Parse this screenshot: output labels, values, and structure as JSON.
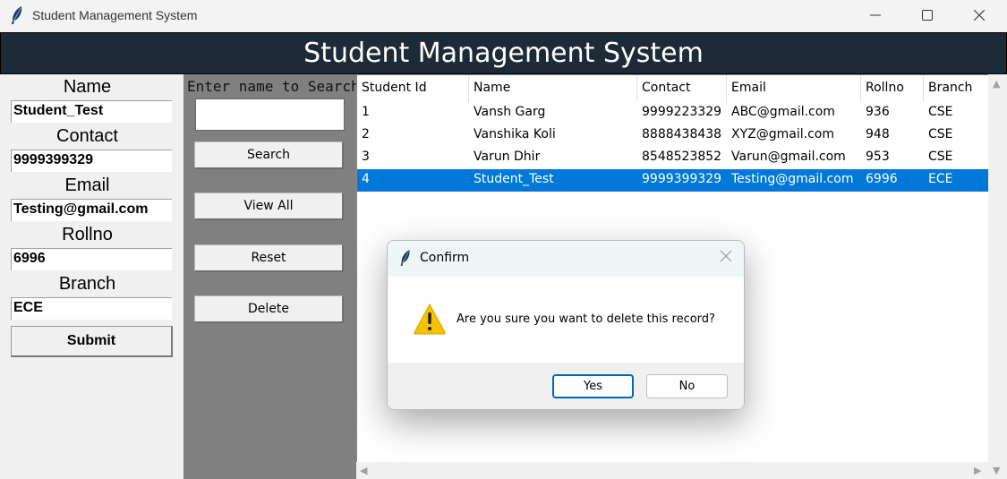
{
  "window": {
    "title": "Student Management System"
  },
  "banner": {
    "title": "Student Management System"
  },
  "form": {
    "name_label": "Name",
    "name_value": "Student_Test",
    "contact_label": "Contact",
    "contact_value": "9999399329",
    "email_label": "Email",
    "email_value": "Testing@gmail.com",
    "rollno_label": "Rollno",
    "rollno_value": "6996",
    "branch_label": "Branch",
    "branch_value": "ECE",
    "submit_label": "Submit"
  },
  "search": {
    "label": "Enter name to Search",
    "value": "",
    "search_label": "Search",
    "view_all_label": "View All",
    "reset_label": "Reset",
    "delete_label": "Delete"
  },
  "table": {
    "columns": [
      "Student Id",
      "Name",
      "Contact",
      "Email",
      "Rollno",
      "Branch"
    ],
    "rows": [
      [
        "1",
        "Vansh Garg",
        "9999223329",
        "ABC@gmail.com",
        "936",
        "CSE"
      ],
      [
        "2",
        "Vanshika Koli",
        "8888438438",
        "XYZ@gmail.com",
        "948",
        "CSE"
      ],
      [
        "3",
        "Varun Dhir",
        "8548523852",
        "Varun@gmail.com",
        "953",
        "CSE"
      ],
      [
        "4",
        "Student_Test",
        "9999399329",
        "Testing@gmail.com",
        "6996",
        "ECE"
      ]
    ],
    "selected_row": 3,
    "selection_color": "#0078d7"
  },
  "dialog": {
    "title": "Confirm",
    "message": "Are you sure you want to delete this record?",
    "icon": "warning-icon",
    "yes_label": "Yes",
    "no_label": "No"
  },
  "colors": {
    "banner_bg": "#1d2a38",
    "search_panel_bg": "#808080",
    "warning": "#f6c100"
  }
}
